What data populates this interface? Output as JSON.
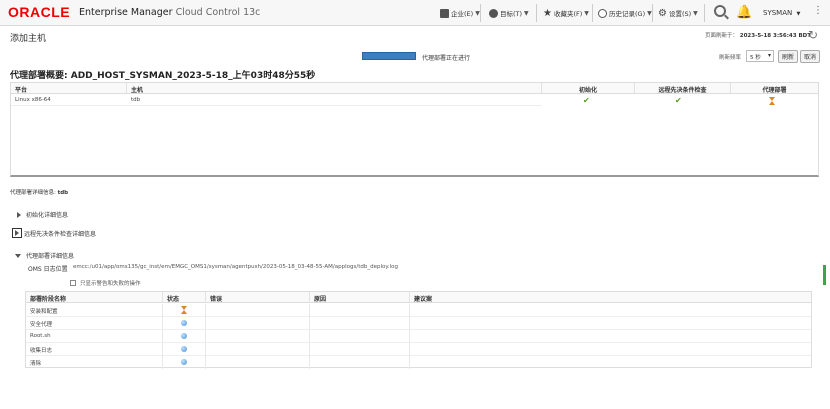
{
  "header": {
    "logo": "ORACLE",
    "product": "Enterprise Manager",
    "product_sub": "Cloud Control 13c",
    "menus": [
      {
        "label": "企业(E)",
        "icon": "enterprise-icon"
      },
      {
        "label": "目标(T)",
        "icon": "target-icon"
      },
      {
        "label": "收藏夹(F)",
        "icon": "star-icon"
      },
      {
        "label": "历史记录(G)",
        "icon": "history-icon"
      },
      {
        "label": "设置(S)",
        "icon": "gear-icon"
      }
    ],
    "user": "SYSMAN",
    "more": "⋮"
  },
  "page": {
    "title": "添加主机",
    "refresh_label": "页面刷新于：",
    "refresh_time": "2023-5-18 3:56:43 BDT"
  },
  "status": {
    "progress_label": "代理部署正在进行",
    "progress": 1.0,
    "rate_label": "刷新频率",
    "rate_value": "5 秒",
    "refresh_button": "刷新",
    "cancel_button": "取消"
  },
  "summary": {
    "title": "代理部署概要: ADD_HOST_SYSMAN_2023-5-18_上午03时48分55秒",
    "columns": [
      "平台",
      "主机",
      "初始化",
      "远程先决条件检查",
      "代理部署"
    ],
    "rows": [
      {
        "platform": "Linux x86-64",
        "host": "tdb",
        "init": "done",
        "prereq": "done",
        "deploy": "in-progress"
      }
    ]
  },
  "details": {
    "label": "代理部署详细信息:",
    "host": "tdb",
    "sections": [
      "初始化详细信息",
      "远程先决条件检查详细信息",
      "代理部署详细信息"
    ],
    "log_label": "OMS 日志位置",
    "log_path": "emcc:/u01/app/oms135/gc_inst/em/EMGC_OMS1/sysman/agentpush/2023-05-18_03-48-55-AM/applogs/tdb_deploy.log",
    "checkbox_label": "只显示警告和失败的操作",
    "columns": [
      "部署阶段名称",
      "状态",
      "错误",
      "原因",
      "建议案"
    ],
    "rows": [
      {
        "name": "安装和配置",
        "status": "in-progress"
      },
      {
        "name": "安全代理",
        "status": "pending"
      },
      {
        "name": "Root.sh",
        "status": "pending"
      },
      {
        "name": "收集日志",
        "status": "pending"
      },
      {
        "name": "清除",
        "status": "pending"
      }
    ]
  }
}
